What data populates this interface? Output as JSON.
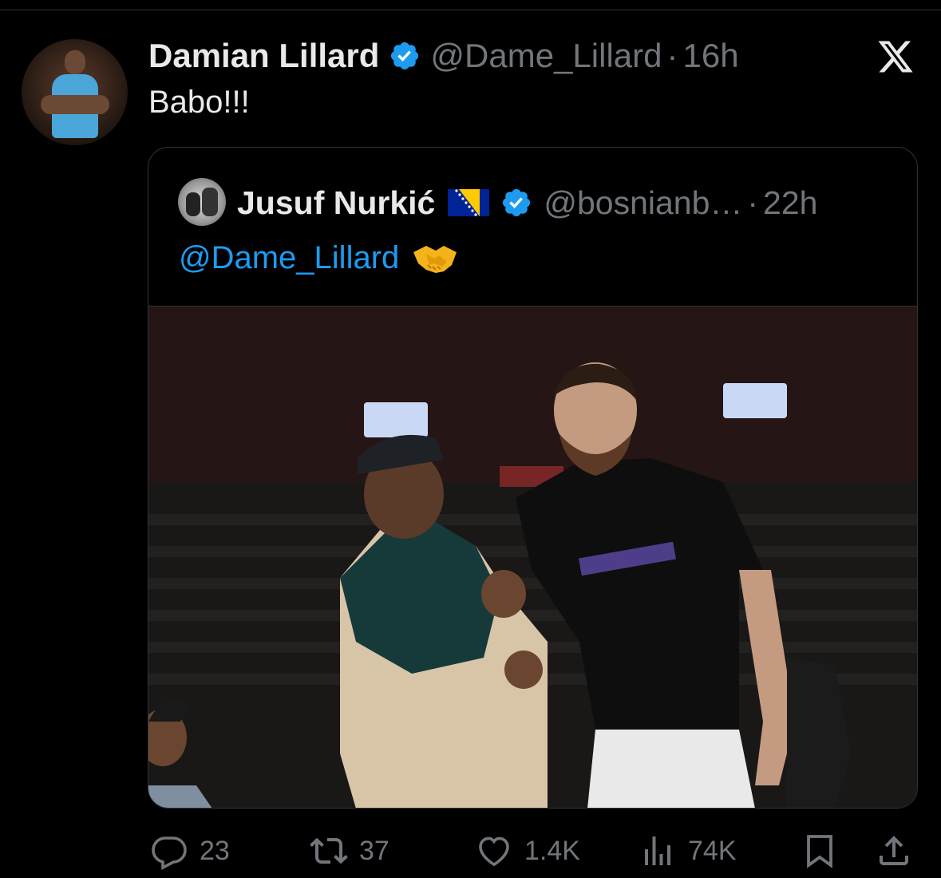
{
  "tweet": {
    "display_name": "Damian Lillard",
    "handle": "@Dame_Lillard",
    "separator": "·",
    "time": "16h",
    "text": "Babo!!!",
    "verified_icon": "verified-badge-icon",
    "platform_logo": "x-logo-icon"
  },
  "quote": {
    "display_name": "Jusuf Nurkić",
    "flag_icon": "bosnia-flag-icon",
    "handle": "@bosnianb…",
    "separator": "·",
    "time": "22h",
    "mention": "@Dame_Lillard",
    "emoji_icon": "handshake-emoji-icon",
    "photo_icon": "two-players-courtside-photo"
  },
  "actions": {
    "replies": "23",
    "reposts": "37",
    "likes": "1.4K",
    "views": "74K"
  },
  "colors": {
    "background": "#000000",
    "text": "#e7e9ea",
    "muted": "#71767b",
    "accent": "#1d9bf0",
    "border": "#2f3336"
  }
}
